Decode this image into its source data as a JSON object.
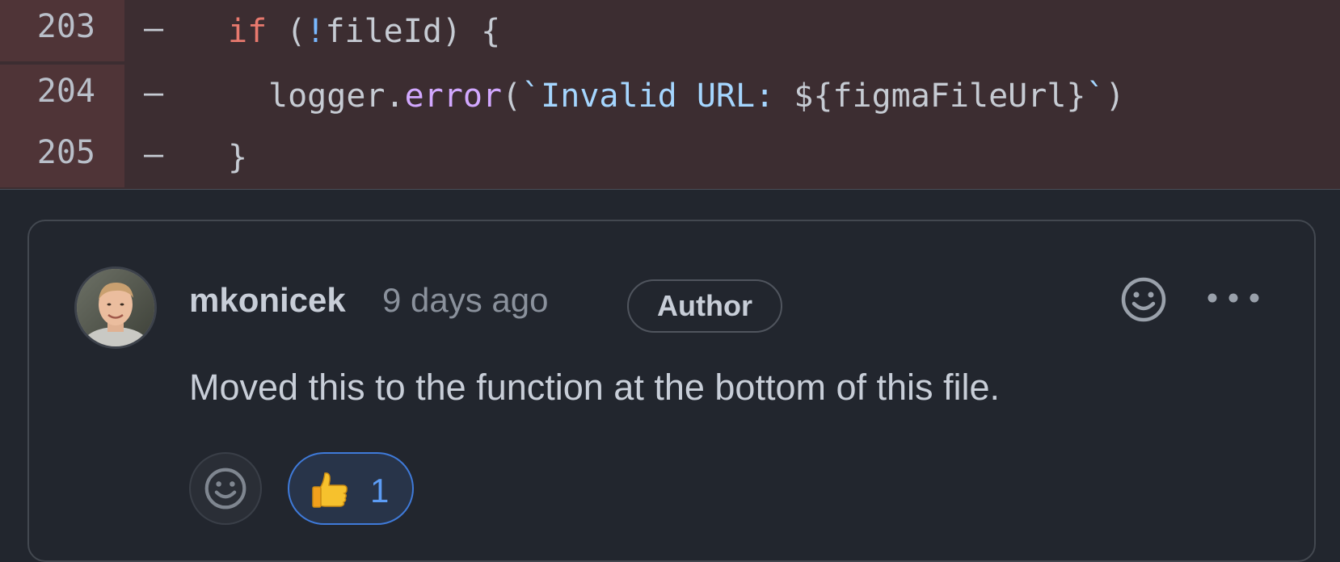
{
  "diff": {
    "lines": [
      {
        "number": "203",
        "marker": "–",
        "tokens": [
          {
            "t": "if ",
            "c": "tk-kw"
          },
          {
            "t": "(",
            "c": "tk-tx"
          },
          {
            "t": "!",
            "c": "tk-op"
          },
          {
            "t": "fileId) {",
            "c": "tk-tx"
          }
        ]
      },
      {
        "number": "204",
        "marker": "–",
        "tokens": [
          {
            "t": "logger.",
            "c": "tk-tx"
          },
          {
            "t": "error",
            "c": "tk-fn"
          },
          {
            "t": "(",
            "c": "tk-tx"
          },
          {
            "t": "`Invalid URL: ",
            "c": "tk-str"
          },
          {
            "t": "${figmaFileUrl}",
            "c": "tk-tx"
          },
          {
            "t": "`",
            "c": "tk-str"
          },
          {
            "t": ")",
            "c": "tk-tx"
          }
        ]
      },
      {
        "number": "205",
        "marker": "–",
        "tokens": [
          {
            "t": "}",
            "c": "tk-tx"
          }
        ]
      }
    ]
  },
  "comment": {
    "author": "mkonicek",
    "time": "9 days ago",
    "badge": "Author",
    "body": "Moved this to the function at the bottom of this file.",
    "reaction": {
      "emoji": "thumbs-up-icon",
      "count": "1"
    }
  },
  "colors": {
    "diff_bg": "#3c2d31",
    "gutter_bg": "#4f3437",
    "page_bg": "#22262e",
    "accent": "#3f7ad9"
  }
}
